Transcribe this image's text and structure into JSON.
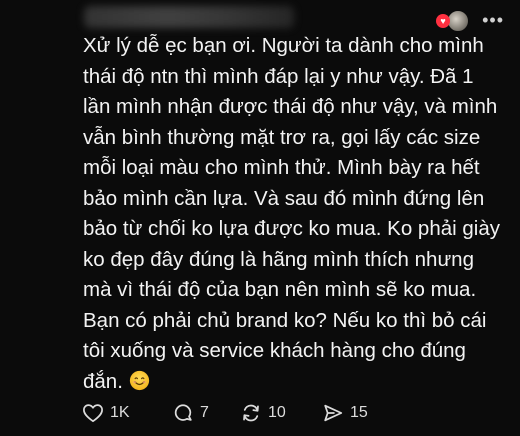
{
  "header": {
    "more_label": "•••",
    "reaction_icon": "heart-icon",
    "accent_color": "#ff3040"
  },
  "comment": {
    "text": "Xử lý dễ ẹc bạn ơi. Người ta dành cho mình thái độ ntn thì mình đáp lại y như vậy. Đã 1 lần mình nhận được thái độ như vậy, và mình vẫn bình thường mặt trơ ra, gọi lấy các size mỗi loại màu cho mình thử. Mình bày ra hết bảo mình cần lựa. Và sau đó mình đứng lên bảo từ chối ko lựa được ko mua. Ko phải giày ko đẹp đây đúng là hãng mình thích nhưng mà vì thái độ của bạn nên mình sẽ ko mua. Bạn có phải chủ brand ko? Nếu ko thì bỏ cái tôi xuống và service khách hàng cho đúng đắn.",
    "emoji": "smiling-face-emoji"
  },
  "actions": {
    "like_count": "1K",
    "reply_count": "7",
    "repost_count": "10",
    "share_count": "15"
  }
}
